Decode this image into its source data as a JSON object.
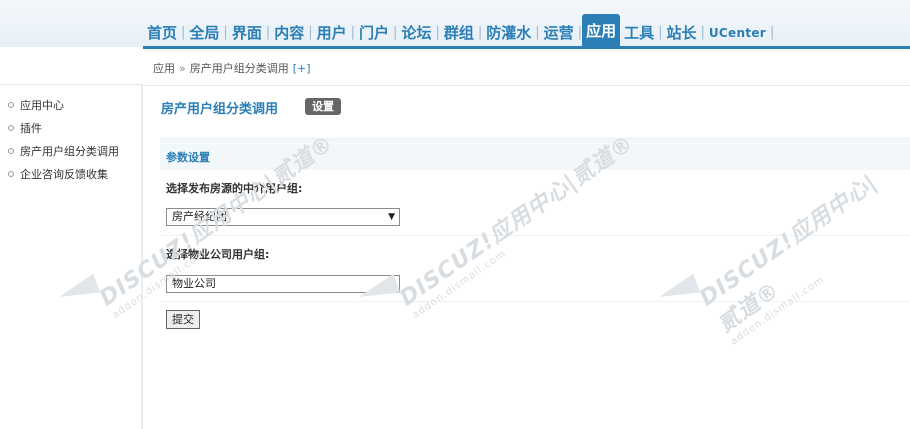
{
  "nav": {
    "items": [
      {
        "label": "首页"
      },
      {
        "label": "全局"
      },
      {
        "label": "界面"
      },
      {
        "label": "内容"
      },
      {
        "label": "用户"
      },
      {
        "label": "门户"
      },
      {
        "label": "论坛"
      },
      {
        "label": "群组"
      },
      {
        "label": "防灌水"
      },
      {
        "label": "运营"
      },
      {
        "label": "应用",
        "active": true
      },
      {
        "label": "工具"
      },
      {
        "label": "站长"
      },
      {
        "label": "UCenter"
      }
    ]
  },
  "breadcrumb": {
    "root": "应用",
    "separator": "»",
    "current": "房产用户组分类调用",
    "toggle": "[+]"
  },
  "sidebar": {
    "items": [
      {
        "label": "应用中心"
      },
      {
        "label": "插件"
      },
      {
        "label": "房产用户组分类调用"
      },
      {
        "label": "企业咨询反馈收集"
      }
    ]
  },
  "main": {
    "title": "房产用户组分类调用",
    "settings_tab": "设置",
    "section_title": "参数设置",
    "fields": [
      {
        "label": "选择发布房源的中介用户组:",
        "value": "房产经纪团"
      },
      {
        "label": "选择物业公司用户组:",
        "value": "物业公司"
      }
    ],
    "submit_label": "提交"
  },
  "watermark": {
    "brand": "DISCUZ!应用中心|贰道®",
    "url": "addon.dismall.com"
  },
  "colors": {
    "accent": "#2b7fb6",
    "tab_bg": "#666666"
  }
}
